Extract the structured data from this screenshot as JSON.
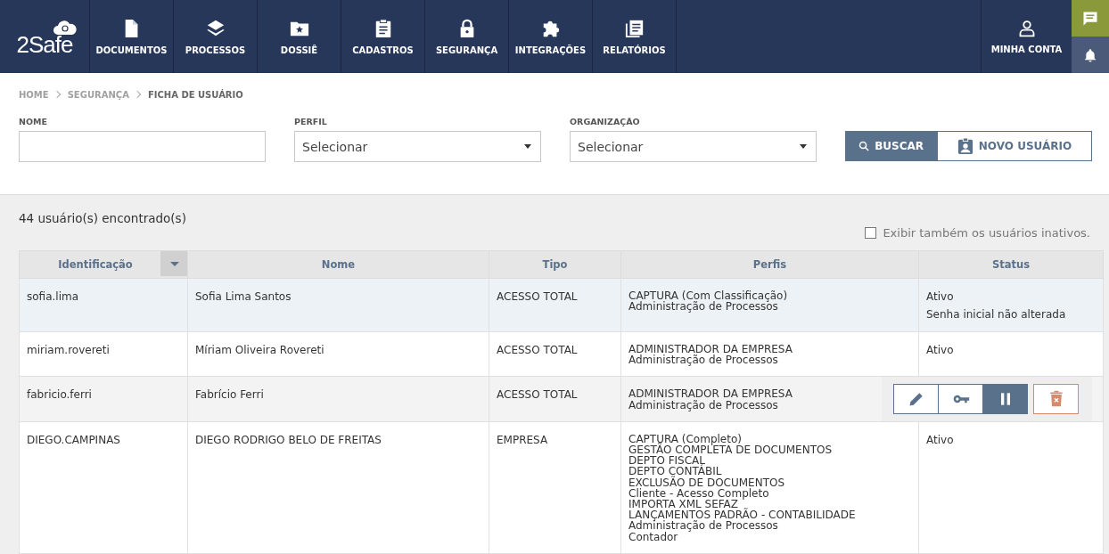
{
  "header": {
    "logo": "2Safe",
    "nav": [
      {
        "label": "DOCUMENTOS",
        "kind": "file"
      },
      {
        "label": "PROCESSOS",
        "kind": "layers"
      },
      {
        "label": "DOSSIÊ",
        "kind": "folder"
      },
      {
        "label": "CADASTROS",
        "kind": "clipboard"
      },
      {
        "label": "SEGURANÇA",
        "kind": "lock"
      },
      {
        "label": "INTEGRAÇÕES",
        "kind": "puzzle"
      },
      {
        "label": "RELATÓRIOS",
        "kind": "report"
      }
    ],
    "account": {
      "label": "MINHA CONTA"
    }
  },
  "breadcrumb": [
    {
      "label": "HOME",
      "current": false
    },
    {
      "label": "SEGURANÇA",
      "current": false
    },
    {
      "label": "FICHA DE USUÁRIO",
      "current": true
    }
  ],
  "filters": [
    {
      "label": "NOME",
      "kind": "text"
    },
    {
      "label": "PERFIL",
      "kind": "select",
      "value": "Selecionar"
    },
    {
      "label": "ORGANIZAÇÃO",
      "kind": "select",
      "value": "Selecionar"
    }
  ],
  "buttons": [
    {
      "label": "BUSCAR",
      "kind": "search"
    },
    {
      "label": "NOVO USUÁRIO",
      "kind": "new-user"
    }
  ],
  "results": {
    "count": "44 usuário(s) encontrado(s)",
    "show_inactive": {
      "label": "Exibir também os usuários inativos.",
      "checked": false
    }
  },
  "table": {
    "columns": [
      {
        "label": "Identificação",
        "sorted": true
      },
      {
        "label": "Nome",
        "sorted": false
      },
      {
        "label": "Tipo",
        "sorted": false
      },
      {
        "label": "Perfis",
        "sorted": false
      },
      {
        "label": "Status",
        "sorted": false
      }
    ],
    "rows": [
      {
        "id": "sofia.lima",
        "name": "Sofia Lima Santos",
        "type": "ACESSO TOTAL",
        "profiles": [
          "CAPTURA (Com Classificação)",
          "Administração de Processos"
        ],
        "status": [
          "Ativo",
          "Senha inicial não alterada"
        ],
        "highlighted": true,
        "hovered": false
      },
      {
        "id": "miriam.rovereti",
        "name": "Míriam Oliveira Rovereti",
        "type": "ACESSO TOTAL",
        "profiles": [
          "ADMINISTRADOR DA EMPRESA",
          "Administração de Processos"
        ],
        "status": [
          "Ativo"
        ],
        "highlighted": false,
        "hovered": false
      },
      {
        "id": "fabricio.ferri",
        "name": "Fabrício Ferri",
        "type": "ACESSO TOTAL",
        "profiles": [
          "ADMINISTRADOR DA EMPRESA",
          "Administração de Processos"
        ],
        "status": [],
        "highlighted": false,
        "hovered": true,
        "actions": [
          {
            "kind": "edit"
          },
          {
            "kind": "key"
          },
          {
            "kind": "pause"
          },
          {
            "kind": "delete"
          }
        ]
      },
      {
        "id": "DIEGO.CAMPINAS",
        "name": "DIEGO RODRIGO BELO DE FREITAS",
        "type": "EMPRESA",
        "profiles": [
          "CAPTURA (Completo)",
          "GESTÃO COMPLETA DE DOCUMENTOS",
          "DEPTO FISCAL",
          "DEPTO CONTÁBIL",
          "EXCLUSÃO DE DOCUMENTOS",
          "Cliente - Acesso Completo",
          "IMPORTA XML SEFAZ",
          "LANÇAMENTOS PADRÃO - CONTABILIDADE",
          "Administração de Processos",
          "Contador"
        ],
        "status": [
          "Ativo"
        ],
        "highlighted": false,
        "hovered": false
      }
    ]
  }
}
